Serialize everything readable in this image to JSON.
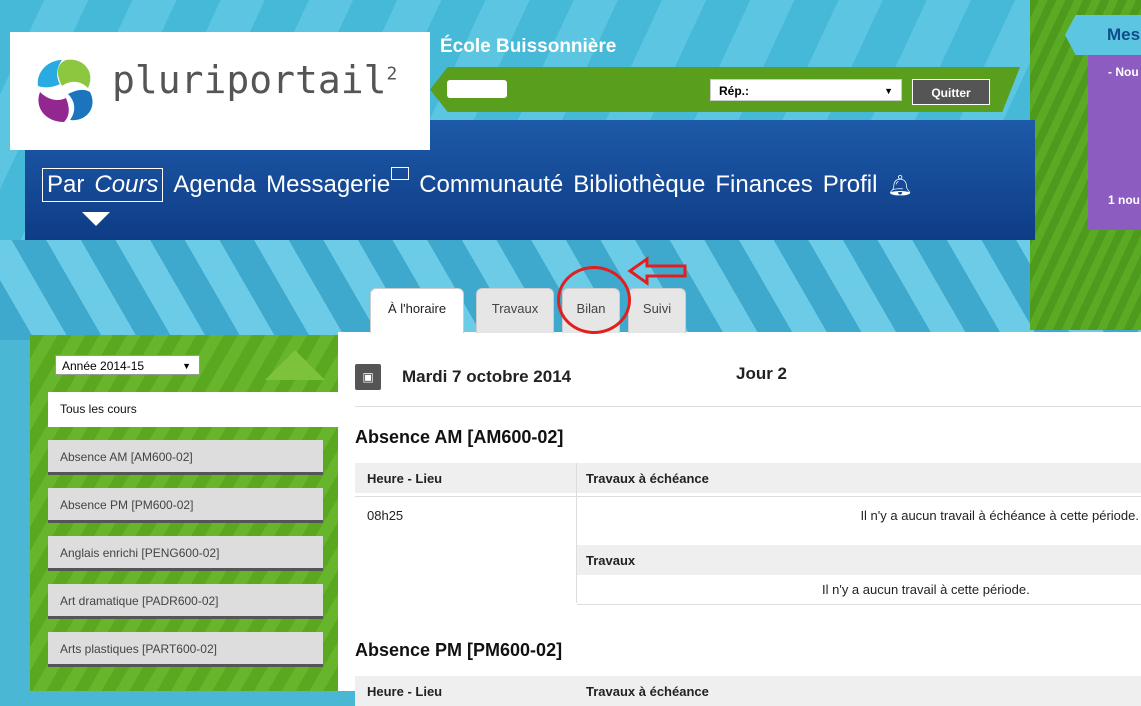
{
  "header": {
    "logo_text": "pluriportail",
    "logo_sup": "2",
    "school_name": "École Buissonnière",
    "rep_label": "Rép.:",
    "quit_label": "Quitter"
  },
  "messages_panel": {
    "title": "Mes",
    "line1": "- Nou",
    "line2": "1 nou"
  },
  "nav": {
    "items": [
      "Agenda",
      "Messagerie",
      "Communauté",
      "Bibliothèque",
      "Finances",
      "Profil"
    ],
    "parcours_prefix": "Par",
    "parcours_suffix": "Cours"
  },
  "tabs": [
    "À l'horaire",
    "Travaux",
    "Bilan",
    "Suivi"
  ],
  "sidebar": {
    "year": "Année 2014-15",
    "items": [
      "Tous les cours",
      "Absence AM [AM600-02]",
      "Absence PM [PM600-02]",
      "Anglais enrichi [PENG600-02]",
      "Art dramatique [PADR600-02]",
      "Arts plastiques [PART600-02]"
    ]
  },
  "main": {
    "date": "Mardi 7 octobre 2014",
    "jour": "Jour 2",
    "sections": [
      {
        "title": "Absence AM [AM600-02]",
        "col1": "Heure - Lieu",
        "col2": "Travaux à échéance",
        "time": "08h25",
        "no_due": "Il n'y a aucun travail à échéance à cette période.",
        "travaux": "Travaux",
        "no_work": "Il n'y a aucun travail à cette période."
      },
      {
        "title": "Absence PM [PM600-02]",
        "col1": "Heure - Lieu",
        "col2": "Travaux à échéance"
      }
    ]
  },
  "colors": {
    "nav_blue": "#1d5aa8",
    "green": "#5a9e1e",
    "annotation_red": "#e02020"
  }
}
